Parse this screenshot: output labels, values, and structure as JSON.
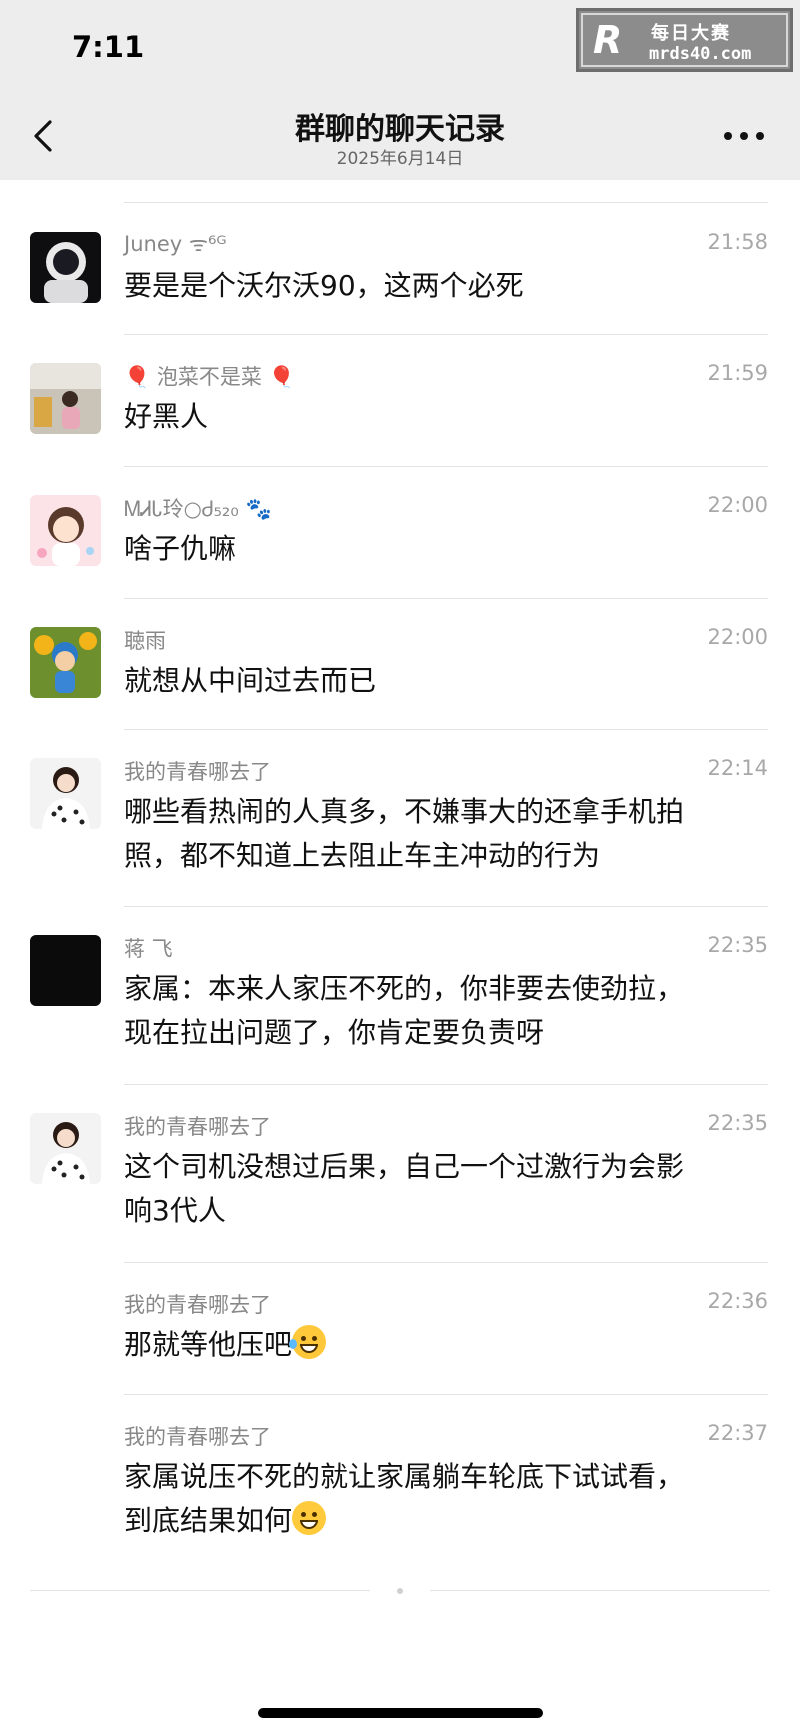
{
  "status": {
    "time": "7:11"
  },
  "watermark": {
    "logo": "R",
    "title": "每日大赛",
    "url": "mrds40.com"
  },
  "header": {
    "title": "群聊的聊天记录",
    "subtitle": "2025年6月14日"
  },
  "messages": [
    {
      "sender": "Juney ᯤ⁶ᴳ",
      "time": "21:58",
      "lines": [
        "要是是个沃尔沃90，这两个必死"
      ],
      "avatar": "astronaut-avatar"
    },
    {
      "sender": "🎈 泡菜不是菜 🎈",
      "time": "21:59",
      "lines": [
        "好黑人"
      ],
      "avatar": "girl-cafe-avatar"
    },
    {
      "sender": "ᎷᏗᏓ玲○Ꮷ₅₂₀ 🐾",
      "time": "22:00",
      "lines": [
        "啥子仇嘛"
      ],
      "avatar": "cartoon-girl-avatar"
    },
    {
      "sender": "聴雨",
      "time": "22:00",
      "lines": [
        "就想从中间过去而已"
      ],
      "avatar": "cartoon-boy-sunflower-avatar"
    },
    {
      "sender": "我的青春哪去了",
      "time": "22:14",
      "lines": [
        "哪些看热闹的人真多，不嫌事大的还拿手机拍",
        "照，都不知道上去阻止车主冲动的行为"
      ],
      "avatar": "girl-polka-avatar"
    },
    {
      "sender": "蒋 飞",
      "time": "22:35",
      "lines": [
        "家属：本来人家压不死的，你非要去使劲拉，",
        "现在拉出问题了，你肯定要负责呀"
      ],
      "avatar": "black-avatar"
    },
    {
      "sender": "我的青春哪去了",
      "time": "22:35",
      "lines": [
        "这个司机没想过后果，自己一个过激行为会影",
        "响3代人"
      ],
      "avatar": "girl-polka-avatar"
    },
    {
      "sender": "我的青春哪去了",
      "time": "22:36",
      "lines": [
        "那就等他压吧"
      ],
      "emoji": "laugh-cry-emoji"
    },
    {
      "sender": "我的青春哪去了",
      "time": "22:37",
      "lines": [
        "家属说压不死的就让家属躺车轮底下试试看，",
        "到底结果如何"
      ],
      "emoji": "grin-emoji"
    }
  ]
}
